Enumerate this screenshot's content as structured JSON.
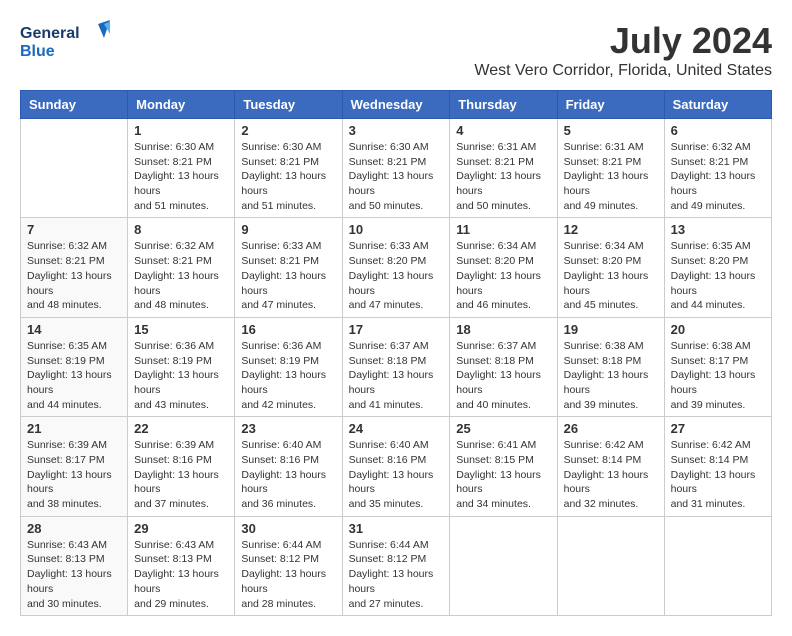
{
  "header": {
    "logo_line1": "General",
    "logo_line2": "Blue",
    "month_year": "July 2024",
    "location": "West Vero Corridor, Florida, United States"
  },
  "days_of_week": [
    "Sunday",
    "Monday",
    "Tuesday",
    "Wednesday",
    "Thursday",
    "Friday",
    "Saturday"
  ],
  "weeks": [
    [
      {
        "day": "",
        "sunrise": "",
        "sunset": "",
        "daylight": ""
      },
      {
        "day": "1",
        "sunrise": "Sunrise: 6:30 AM",
        "sunset": "Sunset: 8:21 PM",
        "daylight": "Daylight: 13 hours and 51 minutes."
      },
      {
        "day": "2",
        "sunrise": "Sunrise: 6:30 AM",
        "sunset": "Sunset: 8:21 PM",
        "daylight": "Daylight: 13 hours and 51 minutes."
      },
      {
        "day": "3",
        "sunrise": "Sunrise: 6:30 AM",
        "sunset": "Sunset: 8:21 PM",
        "daylight": "Daylight: 13 hours and 50 minutes."
      },
      {
        "day": "4",
        "sunrise": "Sunrise: 6:31 AM",
        "sunset": "Sunset: 8:21 PM",
        "daylight": "Daylight: 13 hours and 50 minutes."
      },
      {
        "day": "5",
        "sunrise": "Sunrise: 6:31 AM",
        "sunset": "Sunset: 8:21 PM",
        "daylight": "Daylight: 13 hours and 49 minutes."
      },
      {
        "day": "6",
        "sunrise": "Sunrise: 6:32 AM",
        "sunset": "Sunset: 8:21 PM",
        "daylight": "Daylight: 13 hours and 49 minutes."
      }
    ],
    [
      {
        "day": "7",
        "sunrise": "Sunrise: 6:32 AM",
        "sunset": "Sunset: 8:21 PM",
        "daylight": "Daylight: 13 hours and 48 minutes."
      },
      {
        "day": "8",
        "sunrise": "Sunrise: 6:32 AM",
        "sunset": "Sunset: 8:21 PM",
        "daylight": "Daylight: 13 hours and 48 minutes."
      },
      {
        "day": "9",
        "sunrise": "Sunrise: 6:33 AM",
        "sunset": "Sunset: 8:21 PM",
        "daylight": "Daylight: 13 hours and 47 minutes."
      },
      {
        "day": "10",
        "sunrise": "Sunrise: 6:33 AM",
        "sunset": "Sunset: 8:20 PM",
        "daylight": "Daylight: 13 hours and 47 minutes."
      },
      {
        "day": "11",
        "sunrise": "Sunrise: 6:34 AM",
        "sunset": "Sunset: 8:20 PM",
        "daylight": "Daylight: 13 hours and 46 minutes."
      },
      {
        "day": "12",
        "sunrise": "Sunrise: 6:34 AM",
        "sunset": "Sunset: 8:20 PM",
        "daylight": "Daylight: 13 hours and 45 minutes."
      },
      {
        "day": "13",
        "sunrise": "Sunrise: 6:35 AM",
        "sunset": "Sunset: 8:20 PM",
        "daylight": "Daylight: 13 hours and 44 minutes."
      }
    ],
    [
      {
        "day": "14",
        "sunrise": "Sunrise: 6:35 AM",
        "sunset": "Sunset: 8:19 PM",
        "daylight": "Daylight: 13 hours and 44 minutes."
      },
      {
        "day": "15",
        "sunrise": "Sunrise: 6:36 AM",
        "sunset": "Sunset: 8:19 PM",
        "daylight": "Daylight: 13 hours and 43 minutes."
      },
      {
        "day": "16",
        "sunrise": "Sunrise: 6:36 AM",
        "sunset": "Sunset: 8:19 PM",
        "daylight": "Daylight: 13 hours and 42 minutes."
      },
      {
        "day": "17",
        "sunrise": "Sunrise: 6:37 AM",
        "sunset": "Sunset: 8:18 PM",
        "daylight": "Daylight: 13 hours and 41 minutes."
      },
      {
        "day": "18",
        "sunrise": "Sunrise: 6:37 AM",
        "sunset": "Sunset: 8:18 PM",
        "daylight": "Daylight: 13 hours and 40 minutes."
      },
      {
        "day": "19",
        "sunrise": "Sunrise: 6:38 AM",
        "sunset": "Sunset: 8:18 PM",
        "daylight": "Daylight: 13 hours and 39 minutes."
      },
      {
        "day": "20",
        "sunrise": "Sunrise: 6:38 AM",
        "sunset": "Sunset: 8:17 PM",
        "daylight": "Daylight: 13 hours and 39 minutes."
      }
    ],
    [
      {
        "day": "21",
        "sunrise": "Sunrise: 6:39 AM",
        "sunset": "Sunset: 8:17 PM",
        "daylight": "Daylight: 13 hours and 38 minutes."
      },
      {
        "day": "22",
        "sunrise": "Sunrise: 6:39 AM",
        "sunset": "Sunset: 8:16 PM",
        "daylight": "Daylight: 13 hours and 37 minutes."
      },
      {
        "day": "23",
        "sunrise": "Sunrise: 6:40 AM",
        "sunset": "Sunset: 8:16 PM",
        "daylight": "Daylight: 13 hours and 36 minutes."
      },
      {
        "day": "24",
        "sunrise": "Sunrise: 6:40 AM",
        "sunset": "Sunset: 8:16 PM",
        "daylight": "Daylight: 13 hours and 35 minutes."
      },
      {
        "day": "25",
        "sunrise": "Sunrise: 6:41 AM",
        "sunset": "Sunset: 8:15 PM",
        "daylight": "Daylight: 13 hours and 34 minutes."
      },
      {
        "day": "26",
        "sunrise": "Sunrise: 6:42 AM",
        "sunset": "Sunset: 8:14 PM",
        "daylight": "Daylight: 13 hours and 32 minutes."
      },
      {
        "day": "27",
        "sunrise": "Sunrise: 6:42 AM",
        "sunset": "Sunset: 8:14 PM",
        "daylight": "Daylight: 13 hours and 31 minutes."
      }
    ],
    [
      {
        "day": "28",
        "sunrise": "Sunrise: 6:43 AM",
        "sunset": "Sunset: 8:13 PM",
        "daylight": "Daylight: 13 hours and 30 minutes."
      },
      {
        "day": "29",
        "sunrise": "Sunrise: 6:43 AM",
        "sunset": "Sunset: 8:13 PM",
        "daylight": "Daylight: 13 hours and 29 minutes."
      },
      {
        "day": "30",
        "sunrise": "Sunrise: 6:44 AM",
        "sunset": "Sunset: 8:12 PM",
        "daylight": "Daylight: 13 hours and 28 minutes."
      },
      {
        "day": "31",
        "sunrise": "Sunrise: 6:44 AM",
        "sunset": "Sunset: 8:12 PM",
        "daylight": "Daylight: 13 hours and 27 minutes."
      },
      {
        "day": "",
        "sunrise": "",
        "sunset": "",
        "daylight": ""
      },
      {
        "day": "",
        "sunrise": "",
        "sunset": "",
        "daylight": ""
      },
      {
        "day": "",
        "sunrise": "",
        "sunset": "",
        "daylight": ""
      }
    ]
  ]
}
